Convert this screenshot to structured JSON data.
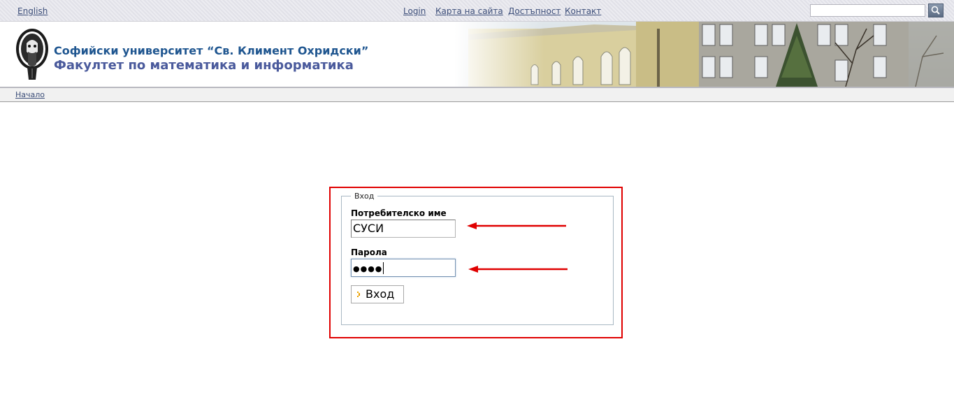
{
  "topbar": {
    "language_link": "English",
    "nav": [
      "Login",
      "Карта на сайта",
      "Достъпност",
      "Контакт"
    ],
    "search_value": "",
    "search_icon": "magnifier-icon"
  },
  "header": {
    "university": "Софийски университет “Св. Климент Охридски”",
    "faculty": "Факултет по математика и информатика",
    "logo_icon": "university-seal-icon"
  },
  "breadcrumb": {
    "home": "Начало"
  },
  "login": {
    "legend": "Вход",
    "username_label": "Потребителско име",
    "username_value": "СУСИ",
    "password_label": "Парола",
    "password_masked": "●●●●",
    "submit_label": "Вход"
  },
  "colors": {
    "highlight_border": "#e00000",
    "link": "#3d4f7a",
    "university_text": "#1f5690",
    "faculty_text": "#4a5a9c"
  }
}
